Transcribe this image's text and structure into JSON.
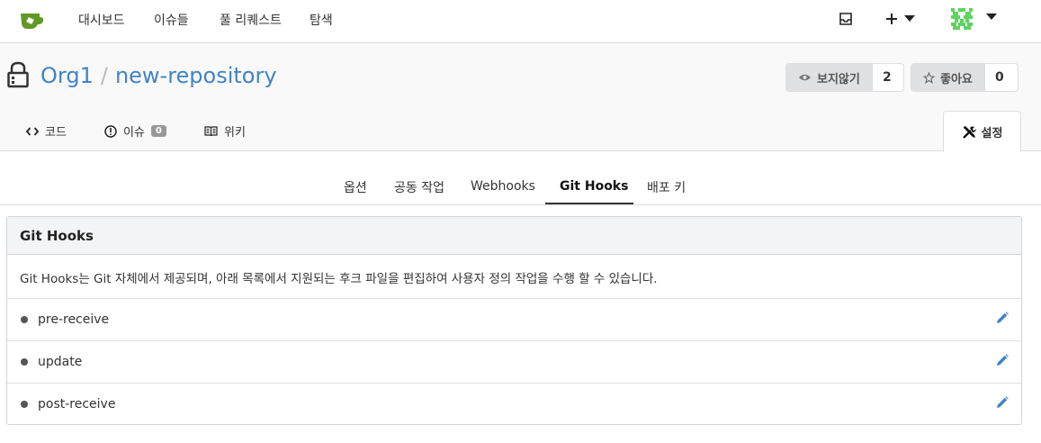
{
  "topnav": {
    "items": [
      "대시보드",
      "이슈들",
      "풀 리퀘스트",
      "탐색"
    ]
  },
  "repo": {
    "owner": "Org1",
    "separator": "/",
    "name": "new-repository",
    "watch_label": "보지않기",
    "watch_count": "2",
    "star_label": "좋아요",
    "star_count": "0"
  },
  "tabs": {
    "code": "코드",
    "issues": "이슈",
    "issues_count": "0",
    "wiki": "위키",
    "settings": "설정"
  },
  "submenu": {
    "items": [
      "옵션",
      "공동 작업",
      "Webhooks",
      "Git Hooks",
      "배포 키"
    ],
    "active": "Git Hooks"
  },
  "panel": {
    "title": "Git Hooks",
    "description": "Git Hooks는 Git 자체에서 제공되며, 아래 목록에서 지원되는 후크 파일을 편집하여 사용자 정의 작업을 수행 할 수 있습니다.",
    "hooks": [
      "pre-receive",
      "update",
      "post-receive"
    ]
  },
  "colors": {
    "link": "#4183c4",
    "logo": "#609926",
    "edit_icon": "#4183c4",
    "avatar": "#5fd35f"
  }
}
